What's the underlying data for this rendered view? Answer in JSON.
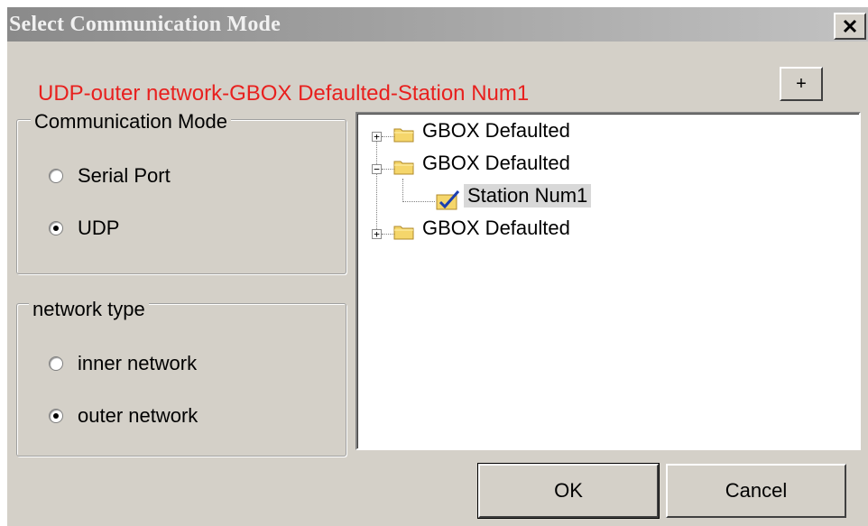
{
  "window": {
    "title": "Select Communication Mode",
    "close_label": "Close"
  },
  "status": {
    "text": "UDP-outer network-GBOX Defaulted-Station Num1",
    "color": "#e8201e"
  },
  "toolbar": {
    "add_label": "+"
  },
  "comm_mode": {
    "legend": "Communication Mode",
    "options": [
      {
        "label": "Serial Port",
        "selected": false
      },
      {
        "label": "UDP",
        "selected": true
      }
    ]
  },
  "network_type": {
    "legend": "network type",
    "options": [
      {
        "label": "inner network",
        "selected": false
      },
      {
        "label": "outer network",
        "selected": true
      }
    ]
  },
  "tree": {
    "nodes": [
      {
        "label": "GBOX Defaulted",
        "expanded": false
      },
      {
        "label": "GBOX Defaulted",
        "expanded": true,
        "children": [
          {
            "label": "Station Num1",
            "selected": true,
            "icon": "checked-station-icon"
          }
        ]
      },
      {
        "label": "GBOX Defaulted",
        "expanded": false
      }
    ]
  },
  "buttons": {
    "ok": "OK",
    "cancel": "Cancel"
  }
}
